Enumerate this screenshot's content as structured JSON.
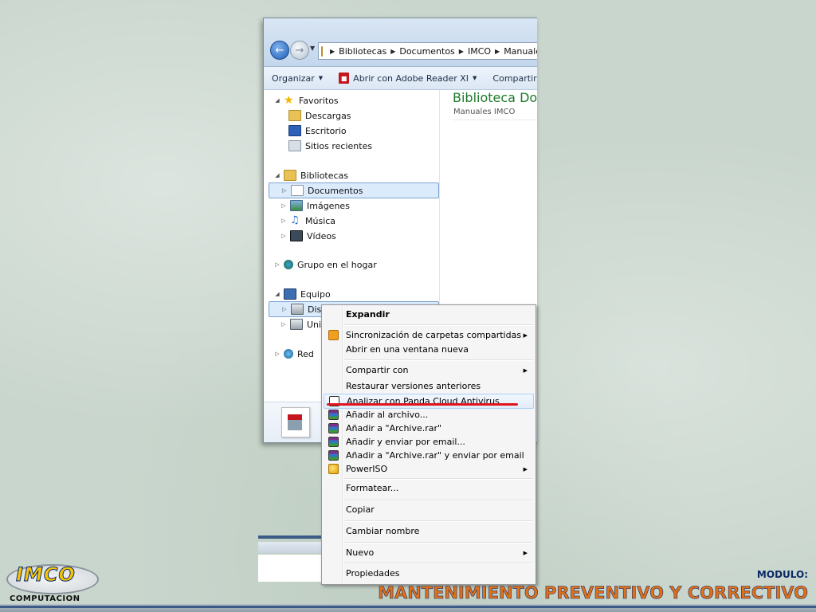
{
  "explorer": {
    "address": {
      "crumbs": [
        "Bibliotecas",
        "Documentos",
        "IMCO",
        "Manuales"
      ]
    },
    "toolbar": {
      "organize": "Organizar",
      "open_with": "Abrir con Adobe Reader XI",
      "share": "Compartir c"
    },
    "nav": {
      "favorites": "Favoritos",
      "downloads": "Descargas",
      "desktop": "Escritorio",
      "recent": "Sitios recientes",
      "libraries": "Bibliotecas",
      "documents": "Documentos",
      "images": "Imágenes",
      "music": "Música",
      "videos": "Vídeos",
      "homegroup": "Grupo en el hogar",
      "computer": "Equipo",
      "disk": "Disco",
      "drive": "Unid",
      "network": "Red"
    },
    "content": {
      "title": "Biblioteca Doc",
      "subtitle": "Manuales IMCO"
    }
  },
  "context_menu": {
    "items": [
      {
        "label": "Expandir"
      },
      {
        "label": "Sincronización de carpetas compartidas"
      },
      {
        "label": "Abrir en una ventana nueva"
      },
      {
        "label": "Compartir con"
      },
      {
        "label": "Restaurar versiones anteriores"
      },
      {
        "label": "Analizar con Panda Cloud Antivirus"
      },
      {
        "label": "Añadir al archivo..."
      },
      {
        "label": "Añadir a \"Archive.rar\""
      },
      {
        "label": "Añadir y enviar por email..."
      },
      {
        "label": "Añadir a \"Archive.rar\" y enviar por email"
      },
      {
        "label": "PowerISO"
      },
      {
        "label": "Formatear..."
      },
      {
        "label": "Copiar"
      },
      {
        "label": "Cambiar nombre"
      },
      {
        "label": "Nuevo"
      },
      {
        "label": "Propiedades"
      }
    ]
  },
  "slide": {
    "logo_text": "IMCO",
    "logo_sub": "COMPUTACION",
    "module_label": "MODULO:",
    "module_title": "MANTENIMIENTO PREVENTIVO Y CORRECTIVO"
  },
  "colors": {
    "highlight_line": "#e0141c",
    "library_title": "#1e7a2b",
    "module_title": "#e0701a"
  }
}
